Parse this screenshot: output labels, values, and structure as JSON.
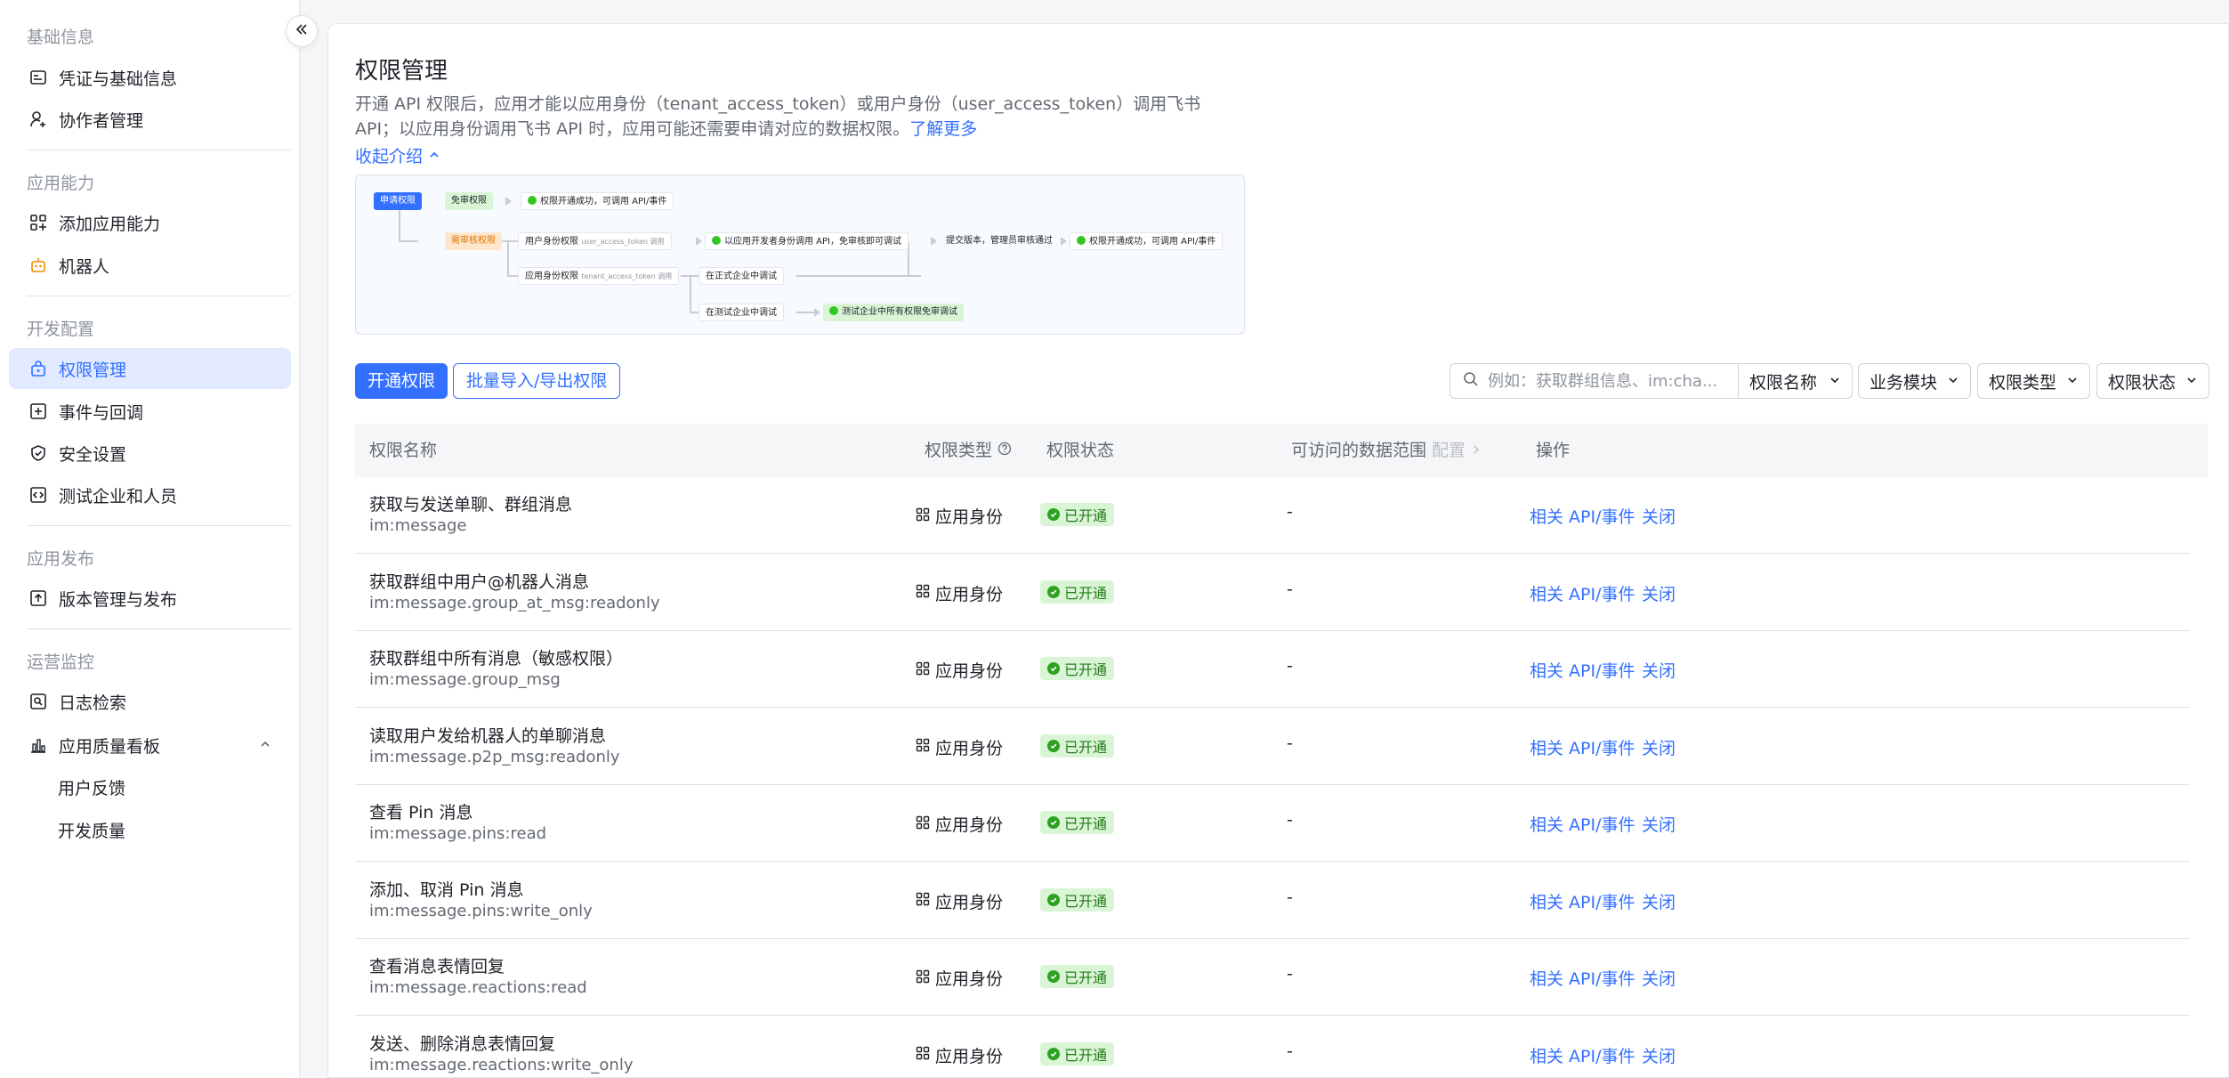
{
  "sidebar": {
    "groups": [
      {
        "title": "基础信息",
        "items": [
          {
            "label": "凭证与基础信息",
            "icon": "id-card-icon"
          },
          {
            "label": "协作者管理",
            "icon": "user-add-icon"
          }
        ]
      },
      {
        "title": "应用能力",
        "items": [
          {
            "label": "添加应用能力",
            "icon": "grid-add-icon"
          },
          {
            "label": "机器人",
            "icon": "robot-icon"
          }
        ]
      },
      {
        "title": "开发配置",
        "items": [
          {
            "label": "权限管理",
            "icon": "permission-icon"
          },
          {
            "label": "事件与回调",
            "icon": "event-icon"
          },
          {
            "label": "安全设置",
            "icon": "shield-icon"
          },
          {
            "label": "测试企业和人员",
            "icon": "code-icon"
          }
        ]
      },
      {
        "title": "应用发布",
        "items": [
          {
            "label": "版本管理与发布",
            "icon": "upload-icon"
          }
        ]
      },
      {
        "title": "运营监控",
        "items": [
          {
            "label": "日志检索",
            "icon": "log-search-icon"
          },
          {
            "label": "应用质量看板",
            "icon": "bar-chart-icon"
          },
          {
            "label": "用户反馈"
          },
          {
            "label": "开发质量"
          }
        ]
      }
    ],
    "active_item": "权限管理"
  },
  "page": {
    "title": "权限管理",
    "intro": "开通 API 权限后，应用才能以应用身份（tenant_access_token）或用户身份（user_access_token）调用飞书 API；以应用身份调用飞书 API 时，应用可能还需要申请对应的数据权限。",
    "learn_more": "了解更多",
    "collapse_intro": "收起介绍"
  },
  "flow": {
    "apply": "申请权限",
    "free": "免审权限",
    "free_result": "权限开通成功，可调用 API/事件",
    "review": "需审核权限",
    "user_perm": "用户身份权限",
    "user_token": "user_access_token 调用",
    "user_dev": "以应用开发者身份调用 API，免审核即可调试",
    "submit": "提交版本，管理员审核通过",
    "final_result": "权限开通成功，可调用 API/事件",
    "app_perm": "应用身份权限",
    "app_token": "tenant_access_token 调用",
    "prod_debug": "在正式企业中调试",
    "test_debug": "在测试企业中调试",
    "test_result": "测试企业中所有权限免审调试"
  },
  "toolbar": {
    "enable_button": "开通权限",
    "batch_button": "批量导入/导出权限",
    "search_placeholder": "例如：获取群组信息、im:cha...",
    "filter_name": "权限名称",
    "filter_module": "业务模块",
    "filter_type": "权限类型",
    "filter_status": "权限状态"
  },
  "table": {
    "headers": {
      "name": "权限名称",
      "type": "权限类型",
      "status": "权限状态",
      "scope": "可访问的数据范围",
      "scope_config": "配置",
      "ops": "操作"
    },
    "rows": [
      {
        "name": "获取与发送单聊、群组消息",
        "code": "im:message",
        "type": "应用身份",
        "status": "已开通",
        "scope": "-",
        "op1": "相关 API/事件",
        "op2": "关闭"
      },
      {
        "name": "获取群组中用户@机器人消息",
        "code": "im:message.group_at_msg:readonly",
        "type": "应用身份",
        "status": "已开通",
        "scope": "-",
        "op1": "相关 API/事件",
        "op2": "关闭"
      },
      {
        "name": "获取群组中所有消息（敏感权限）",
        "code": "im:message.group_msg",
        "type": "应用身份",
        "status": "已开通",
        "scope": "-",
        "op1": "相关 API/事件",
        "op2": "关闭"
      },
      {
        "name": "读取用户发给机器人的单聊消息",
        "code": "im:message.p2p_msg:readonly",
        "type": "应用身份",
        "status": "已开通",
        "scope": "-",
        "op1": "相关 API/事件",
        "op2": "关闭"
      },
      {
        "name": "查看 Pin 消息",
        "code": "im:message.pins:read",
        "type": "应用身份",
        "status": "已开通",
        "scope": "-",
        "op1": "相关 API/事件",
        "op2": "关闭"
      },
      {
        "name": "添加、取消 Pin 消息",
        "code": "im:message.pins:write_only",
        "type": "应用身份",
        "status": "已开通",
        "scope": "-",
        "op1": "相关 API/事件",
        "op2": "关闭"
      },
      {
        "name": "查看消息表情回复",
        "code": "im:message.reactions:read",
        "type": "应用身份",
        "status": "已开通",
        "scope": "-",
        "op1": "相关 API/事件",
        "op2": "关闭"
      },
      {
        "name": "发送、删除消息表情回复",
        "code": "im:message.reactions:write_only",
        "type": "应用身份",
        "status": "已开通",
        "scope": "-",
        "op1": "相关 API/事件",
        "op2": "关闭"
      }
    ]
  },
  "colors": {
    "accent": "#3370ff",
    "active_bg": "#e1eaff",
    "success": "#2ea121",
    "success_bg": "#d9f5d6"
  }
}
